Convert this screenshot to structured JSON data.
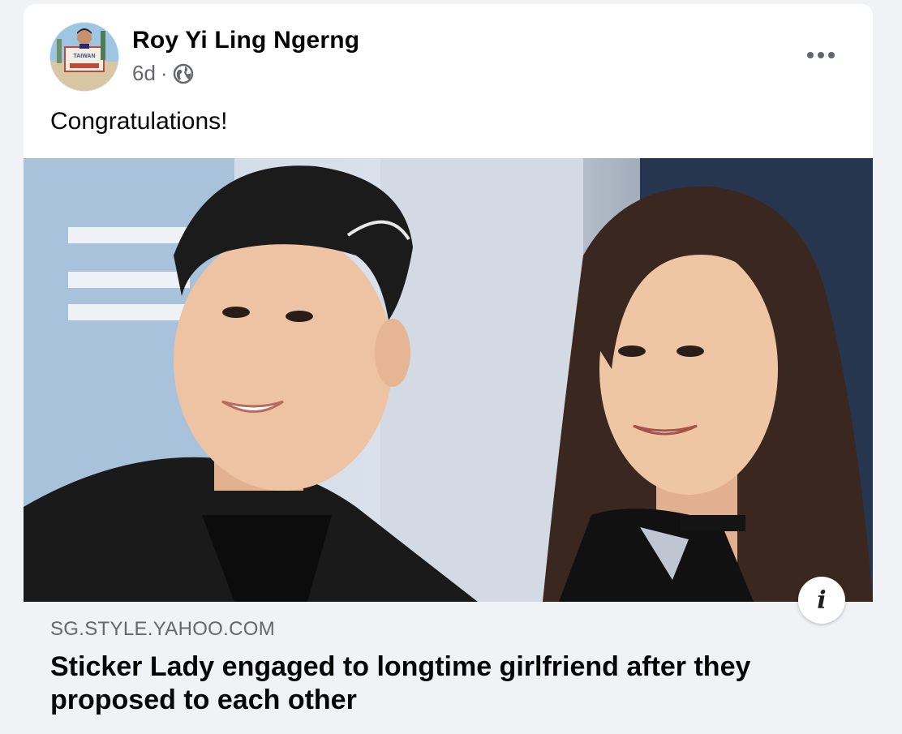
{
  "post": {
    "author": "Roy Yi Ling Ngerng",
    "age": "6d",
    "separator": "·",
    "privacy_icon": "globe-icon",
    "message": "Congratulations!",
    "more_icon": "more-options-icon",
    "avatar_text": "TAIWAN"
  },
  "link": {
    "domain": "SG.STYLE.YAHOO.COM",
    "headline": "Sticker Lady engaged to longtime girlfriend after they proposed to each other",
    "info_glyph": "i"
  },
  "colors": {
    "background": "#f0f2f5",
    "card": "#ffffff",
    "primary_text": "#050505",
    "secondary_text": "#65676b"
  }
}
